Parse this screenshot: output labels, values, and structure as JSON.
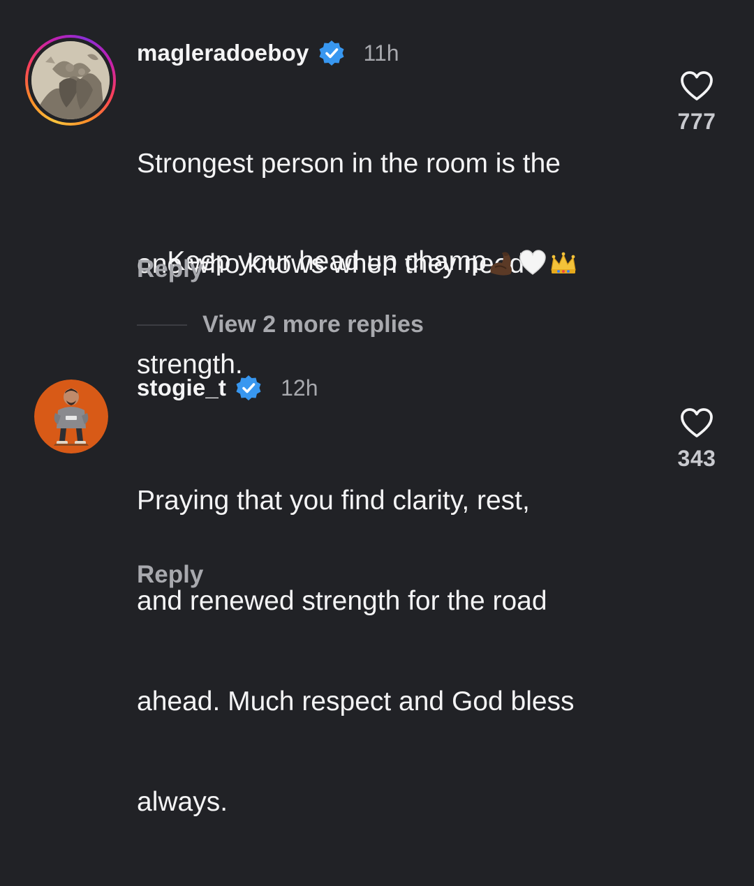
{
  "comments": [
    {
      "username": "magleradoeboy",
      "verified": true,
      "time": "11h",
      "text_line1": "Strongest person in the room is the",
      "text_line2": "one who knows when they need",
      "text_line3": "strength.",
      "text_line4": "Keep your head up champ",
      "emojis": [
        "flexed-biceps-icon",
        "white-heart-icon",
        "crown-icon"
      ],
      "reply_label": "Reply",
      "likes": "777",
      "avatar": "engraving-artwork-avatar",
      "has_story_ring": true
    },
    {
      "username": "stogie_t",
      "verified": true,
      "time": "12h",
      "text_line1": "Praying that you find clarity, rest,",
      "text_line2": "and renewed strength for the road",
      "text_line3": "ahead. Much respect and God bless",
      "text_line4": "always.",
      "reply_label": "Reply",
      "likes": "343",
      "avatar": "cartoon-man-orange-avatar",
      "has_story_ring": false
    }
  ],
  "view_more_replies": "View 2 more replies",
  "colors": {
    "background": "#212226",
    "text_primary": "#f4f4f5",
    "text_secondary": "#a8a9ae",
    "verified_blue": "#3897f0",
    "avatar2_bg": "#d85a17"
  }
}
